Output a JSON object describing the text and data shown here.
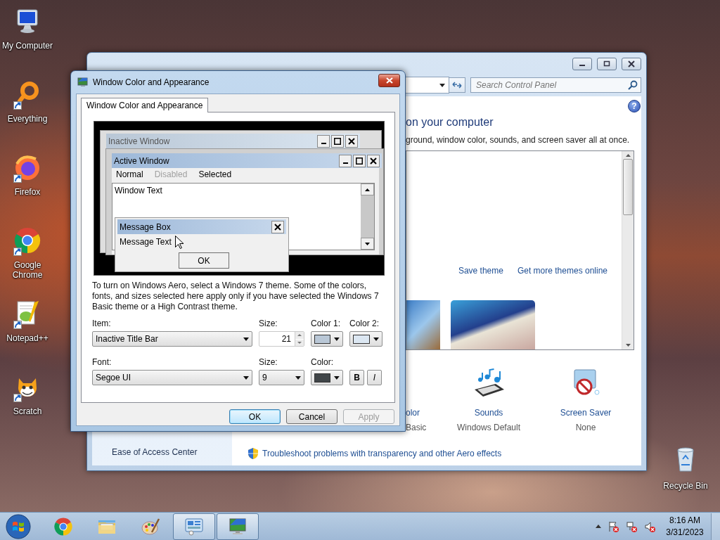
{
  "desktop_icons": [
    {
      "label": "My Computer",
      "kind": "computer",
      "shortcut": false
    },
    {
      "label": "Everything",
      "kind": "everything",
      "shortcut": true
    },
    {
      "label": "Firefox",
      "kind": "firefox",
      "shortcut": true
    },
    {
      "label": "Google Chrome",
      "kind": "chrome",
      "shortcut": true
    },
    {
      "label": "Notepad++",
      "kind": "notepad",
      "shortcut": true
    },
    {
      "label": "Scratch",
      "kind": "scratch",
      "shortcut": true
    }
  ],
  "recycle_bin": {
    "label": "Recycle Bin"
  },
  "control_panel_window": {
    "search": {
      "placeholder": "Search Control Panel"
    },
    "help_glyph": "?",
    "heading": "on your computer",
    "subtitle": "ground, window color, sounds, and screen saver all at once.",
    "theme_links": [
      "Save theme",
      "Get more themes online"
    ],
    "settings": [
      {
        "kind": "color",
        "title": "olor",
        "value": "Basic"
      },
      {
        "kind": "sounds",
        "title": "Sounds",
        "value": "Windows Default"
      },
      {
        "kind": "screensaver",
        "title": "Screen Saver",
        "value": "None"
      }
    ],
    "sidebar_items": [
      "Ease of Access Center"
    ],
    "troubleshoot_link": "Troubleshoot problems with transparency and other Aero effects"
  },
  "dialog": {
    "title": "Window Color and Appearance",
    "tabs": [
      {
        "label": "Window Color and Appearance",
        "selected": true
      }
    ],
    "preview": {
      "inactive_title": "Inactive Window",
      "active_title": "Active Window",
      "menu": [
        {
          "label": "Normal",
          "disabled": false
        },
        {
          "label": "Disabled",
          "disabled": true
        },
        {
          "label": "Selected",
          "disabled": false
        }
      ],
      "window_text": "Window Text",
      "message_title": "Message Box",
      "message_text": "Message Text",
      "message_button": "OK"
    },
    "description": "To turn on Windows Aero, select a Windows 7 theme.  Some of the colors, fonts, and sizes selected here apply only if you have selected the Windows 7 Basic theme or a High Contrast theme.",
    "item": {
      "label": "Item:",
      "value": "Inactive Title Bar"
    },
    "item_size": {
      "label": "Size:",
      "value": "21"
    },
    "color_1": {
      "label": "Color 1:",
      "color": "#b9c7d6"
    },
    "color_2": {
      "label": "Color 2:",
      "color": "#dce7f2"
    },
    "font": {
      "label": "Font:",
      "value": "Segoe UI"
    },
    "font_size": {
      "label": "Size:",
      "value": "9"
    },
    "font_color": {
      "label": "Color:",
      "color": "#404548"
    },
    "style_buttons": [
      {
        "label": "B",
        "kind": "bold"
      },
      {
        "label": "I",
        "kind": "italic"
      }
    ],
    "buttons": [
      {
        "label": "OK",
        "default": true,
        "disabled": false
      },
      {
        "label": "Cancel",
        "default": false,
        "disabled": false
      },
      {
        "label": "Apply",
        "default": false,
        "disabled": true
      }
    ]
  },
  "taskbar": {
    "items": [
      {
        "kind": "chrome",
        "active": false
      },
      {
        "kind": "explorer",
        "active": false
      },
      {
        "kind": "paint",
        "active": false
      },
      {
        "kind": "control_panel",
        "active": true
      },
      {
        "kind": "display",
        "active": true
      }
    ],
    "time": "8:16 AM",
    "date": "3/31/2023"
  }
}
